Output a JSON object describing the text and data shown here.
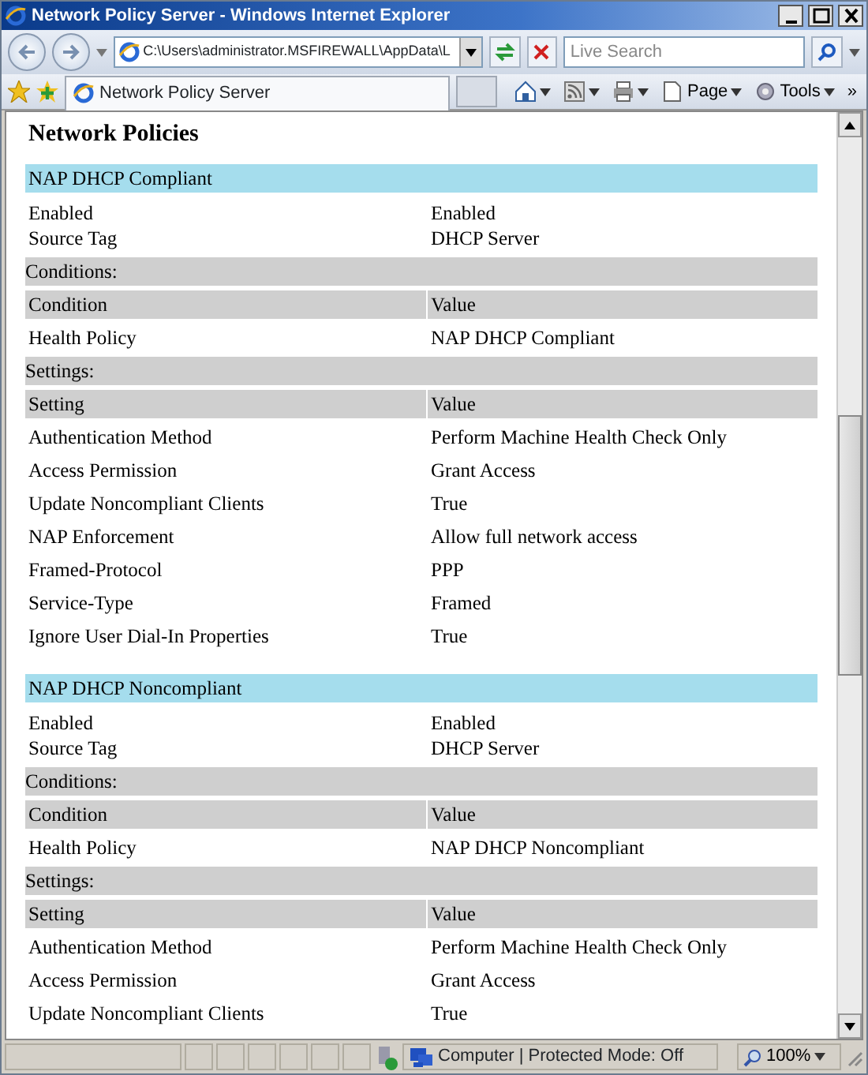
{
  "window": {
    "title": "Network Policy Server - Windows Internet Explorer"
  },
  "address_bar": {
    "value": "C:\\Users\\administrator.MSFIREWALL\\AppData\\L"
  },
  "search": {
    "placeholder": "Live Search"
  },
  "tab": {
    "label": "Network Policy Server",
    "selected": true
  },
  "command_bar": [
    {
      "kind": "home"
    },
    {
      "kind": "feeds"
    },
    {
      "kind": "print"
    },
    {
      "kind": "page",
      "label": "Page"
    },
    {
      "kind": "tools",
      "label": "Tools"
    },
    {
      "kind": "more",
      "label": "»"
    }
  ],
  "page": {
    "heading": "Network Policies",
    "policies": [
      {
        "name": "NAP DHCP Compliant",
        "properties": [
          {
            "label": "Enabled",
            "value": "Enabled"
          },
          {
            "label": "Source Tag",
            "value": "DHCP Server"
          }
        ],
        "conditions_label": "Conditions:",
        "conditions_header": [
          "Condition",
          "Value"
        ],
        "conditions": [
          {
            "label": "Health Policy",
            "value": "NAP DHCP Compliant"
          }
        ],
        "settings_label": "Settings:",
        "settings_header": [
          "Setting",
          "Value"
        ],
        "settings": [
          {
            "label": "Authentication Method",
            "value": "Perform Machine Health Check Only"
          },
          {
            "label": "Access Permission",
            "value": "Grant Access"
          },
          {
            "label": "Update Noncompliant Clients",
            "value": "True"
          },
          {
            "label": "NAP Enforcement",
            "value": "Allow full network access"
          },
          {
            "label": "Framed-Protocol",
            "value": "PPP"
          },
          {
            "label": "Service-Type",
            "value": "Framed"
          },
          {
            "label": "Ignore User Dial-In Properties",
            "value": "True"
          }
        ]
      },
      {
        "name": "NAP DHCP Noncompliant",
        "properties": [
          {
            "label": "Enabled",
            "value": "Enabled"
          },
          {
            "label": "Source Tag",
            "value": "DHCP Server"
          }
        ],
        "conditions_label": "Conditions:",
        "conditions_header": [
          "Condition",
          "Value"
        ],
        "conditions": [
          {
            "label": "Health Policy",
            "value": "NAP DHCP Noncompliant"
          }
        ],
        "settings_label": "Settings:",
        "settings_header": [
          "Setting",
          "Value"
        ],
        "settings": [
          {
            "label": "Authentication Method",
            "value": "Perform Machine Health Check Only"
          },
          {
            "label": "Access Permission",
            "value": "Grant Access"
          },
          {
            "label": "Update Noncompliant Clients",
            "value": "True"
          }
        ]
      }
    ]
  },
  "status_bar": {
    "zone": "Computer | Protected Mode: Off",
    "zoom": "100%"
  }
}
